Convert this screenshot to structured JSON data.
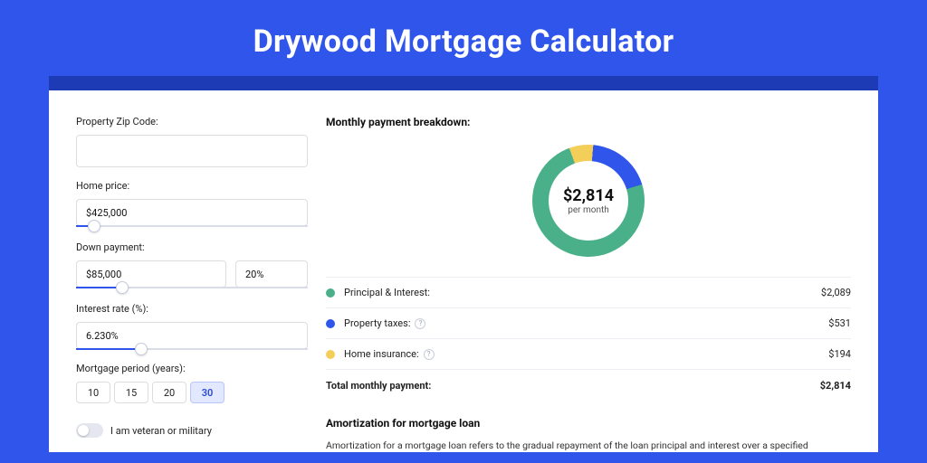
{
  "header": {
    "title": "Drywood Mortgage Calculator"
  },
  "form": {
    "zip": {
      "label": "Property Zip Code:",
      "value": ""
    },
    "home": {
      "label": "Home price:",
      "value": "$425,000",
      "slider_pct": 8
    },
    "down": {
      "label": "Down payment:",
      "value": "$85,000",
      "pct": "20%",
      "slider_pct": 20
    },
    "rate": {
      "label": "Interest rate (%):",
      "value": "6.230%",
      "slider_pct": 28
    },
    "term": {
      "label": "Mortgage period (years):",
      "options": [
        "10",
        "15",
        "20",
        "30"
      ],
      "active": "30"
    },
    "veteran": {
      "label": "I am veteran or military"
    }
  },
  "breakdown": {
    "title": "Monthly payment breakdown:",
    "center_value": "$2,814",
    "center_unit": "per month",
    "rows": [
      {
        "bullet": "green",
        "name": "Principal & Interest:",
        "value": "$2,089",
        "hint": false
      },
      {
        "bullet": "blue",
        "name": "Property taxes:",
        "value": "$531",
        "hint": true
      },
      {
        "bullet": "yellow",
        "name": "Home insurance:",
        "value": "$194",
        "hint": true
      }
    ],
    "total_label": "Total monthly payment:",
    "total_value": "$2,814"
  },
  "chart_data": {
    "type": "pie",
    "title": "Monthly payment breakdown",
    "series": [
      {
        "name": "Principal & Interest",
        "value": 2089,
        "color": "#49b08a"
      },
      {
        "name": "Property taxes",
        "value": 531,
        "color": "#2f55eb"
      },
      {
        "name": "Home insurance",
        "value": 194,
        "color": "#f3ce58"
      }
    ],
    "total": 2814,
    "unit": "USD per month"
  },
  "amort": {
    "title": "Amortization for mortgage loan",
    "text": "Amortization for a mortgage loan refers to the gradual repayment of the loan principal and interest over a specified"
  }
}
